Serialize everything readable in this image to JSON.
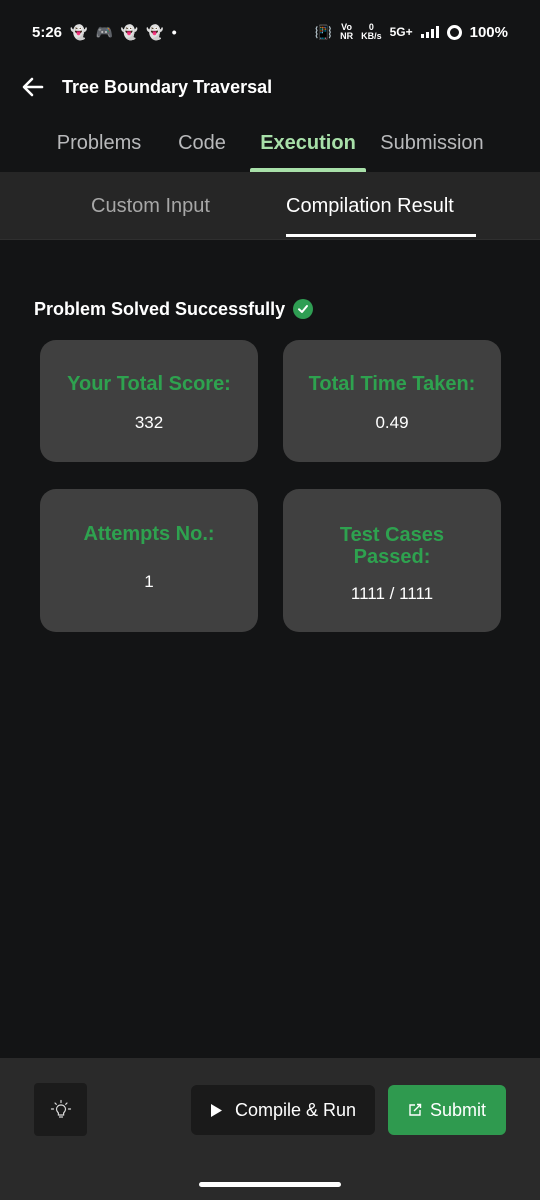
{
  "status_bar": {
    "time": "5:26",
    "net_top": "Vo",
    "net_bottom": "NR",
    "speed_value": "0",
    "speed_unit": "KB/s",
    "network": "5G+",
    "battery": "100%"
  },
  "header": {
    "title": "Tree Boundary Traversal"
  },
  "main_tabs": [
    {
      "label": "Problems"
    },
    {
      "label": "Code"
    },
    {
      "label": "Execution"
    },
    {
      "label": "Submission"
    }
  ],
  "sub_tabs": [
    {
      "label": "Custom Input"
    },
    {
      "label": "Compilation Result"
    }
  ],
  "result": {
    "message": "Problem Solved Successfully",
    "cards": [
      {
        "label": "Your Total Score:",
        "value": "332"
      },
      {
        "label": "Total Time Taken:",
        "value": "0.49"
      },
      {
        "label": "Attempts No.:",
        "value": "1"
      },
      {
        "label": "Test Cases Passed:",
        "value": "1111 / 1111"
      }
    ]
  },
  "actions": {
    "compile_label": "Compile & Run",
    "submit_label": "Submit"
  },
  "colors": {
    "accent_green": "#2ea24f",
    "active_tab": "#a8e0a9",
    "card_bg": "#404040"
  }
}
